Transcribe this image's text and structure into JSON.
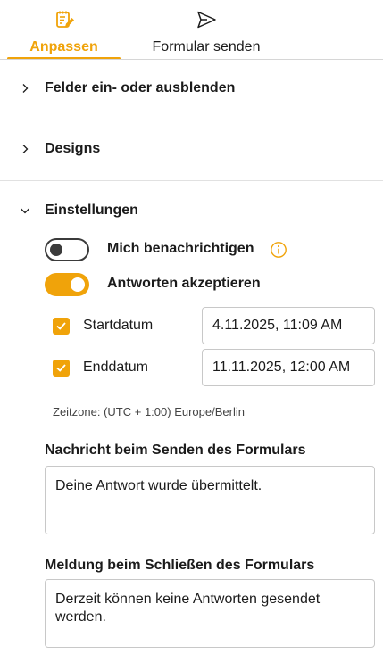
{
  "tabs": {
    "customize": {
      "label": "Anpassen",
      "icon": "edit-note-icon",
      "active": true
    },
    "send": {
      "label": "Formular senden",
      "icon": "send-icon",
      "active": false
    }
  },
  "sections": {
    "fields": {
      "title": "Felder ein- oder ausblenden",
      "expanded": false
    },
    "designs": {
      "title": "Designs",
      "expanded": false
    },
    "settings": {
      "title": "Einstellungen",
      "expanded": true
    }
  },
  "settings": {
    "notify": {
      "label": "Mich benachrichtigen",
      "on": false,
      "info_icon": "info-icon"
    },
    "accept": {
      "label": "Antworten akzeptieren",
      "on": true
    },
    "start": {
      "label": "Startdatum",
      "checked": true,
      "value": "4.11.2025, 11:09 AM"
    },
    "end": {
      "label": "Enddatum",
      "checked": true,
      "value": "11.11.2025, 12:00 AM"
    },
    "timezone": "Zeitzone: (UTC + 1:00) Europe/Berlin",
    "submit_message": {
      "title": "Nachricht beim Senden des Formulars",
      "value": "Deine Antwort wurde übermittelt."
    },
    "closed_message": {
      "title": "Meldung beim Schließen des Formulars",
      "value": "Derzeit können keine Antworten gesendet werden."
    }
  },
  "colors": {
    "accent": "#f0a30a",
    "text": "#1b1b1b",
    "border": "#c8c8c8",
    "divider": "#e1e1e1"
  }
}
